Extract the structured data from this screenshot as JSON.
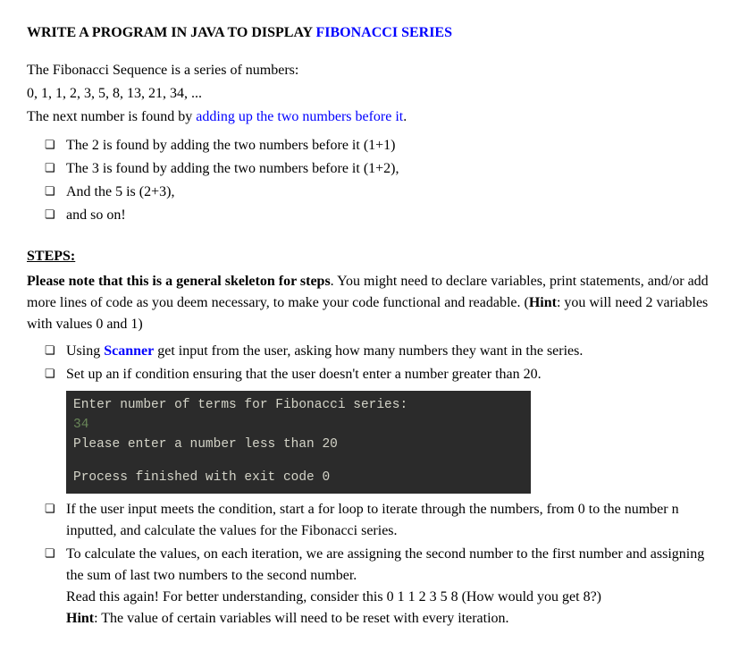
{
  "title": {
    "prefix": "WRITE A PROGRAM IN JAVA TO DISPLAY ",
    "highlight": "FIBONACCI SERIES"
  },
  "intro": {
    "line1": "The Fibonacci Sequence is a series of numbers:",
    "line2": "0, 1, 1, 2, 3, 5, 8, 13, 21, 34, ...",
    "line3_a": "The next number is found by ",
    "line3_link": "adding up the two numbers before it",
    "line3_b": "."
  },
  "bullets1": [
    "The 2 is found by adding the two numbers before it (1+1)",
    "The 3 is found by adding the two numbers before it (1+2),",
    "And the 5 is (2+3),",
    "and so on!"
  ],
  "steps": {
    "heading": "STEPS",
    "colon": ":",
    "note_bold": "Please note that this is a general skeleton for steps",
    "note_rest": ". You might need to declare variables, print statements, and/or add more lines of code as you deem necessary, to make your code functional and readable. (",
    "hint_label": "Hint",
    "hint_rest": ": you will need 2 variables with values 0 and 1)"
  },
  "bullets2a": {
    "item1_a": "Using ",
    "item1_link": "Scanner",
    "item1_b": " get input from the user, asking how many numbers they want in the series.",
    "item2": "Set up an if condition ensuring that the user doesn't enter a number greater than 20."
  },
  "code": {
    "l1": "Enter number of terms for Fibonacci series:",
    "l2": "34",
    "l3": "Please enter a number less than 20",
    "l4": "Process finished with exit code 0"
  },
  "bullets2b": {
    "item3": "If the user input meets the condition, start a for loop to iterate through the numbers, from 0 to the number n inputted, and calculate the values for the Fibonacci series.",
    "item4_a": "To calculate the values, on each iteration, we are assigning the second number to the first number and assigning the sum of last two numbers to the second number.",
    "item4_b": "Read this again! For better understanding, consider this 0 1 1 2 3 5 8 (How would you get 8?)",
    "item4_hint_label": "Hint",
    "item4_hint_rest": ": The value of certain variables will need to be reset with every iteration."
  }
}
